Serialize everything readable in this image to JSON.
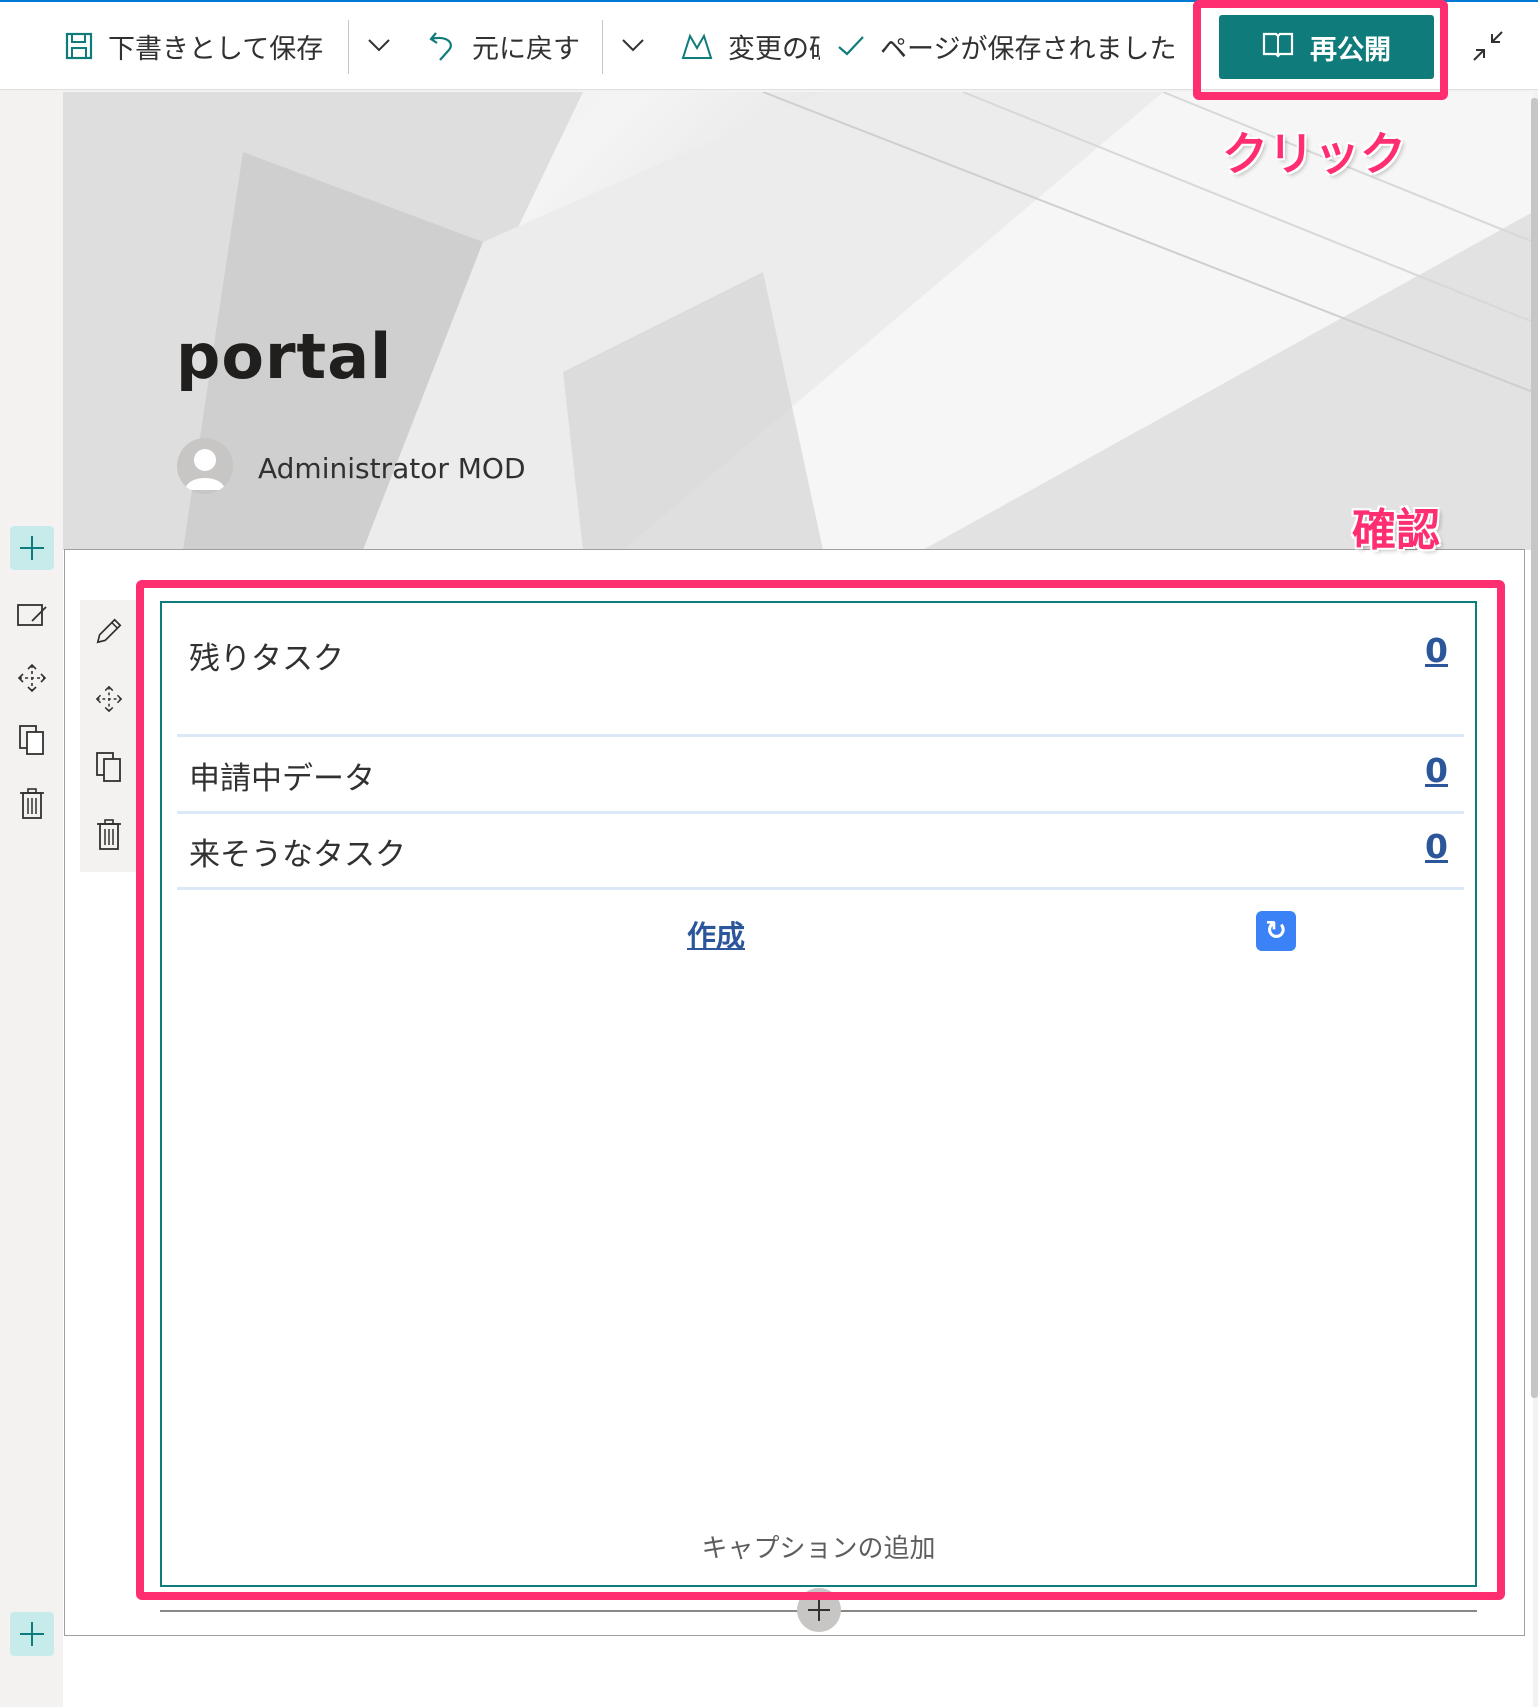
{
  "command_bar": {
    "save_draft_label": "下書きとして保存",
    "undo_label": "元に戻す",
    "discard_label": "変更の破",
    "saved_status": "ページが保存されました",
    "republish_label": "再公開"
  },
  "annotations": {
    "click_label": "クリック",
    "confirm_label": "確認",
    "color": "#ff2e71"
  },
  "page": {
    "title": "portal",
    "author": "Administrator MOD"
  },
  "webpart": {
    "rows": [
      {
        "label": "残りタスク",
        "count": "0"
      },
      {
        "label": "申請中データ",
        "count": "0"
      },
      {
        "label": "来そうなタスク",
        "count": "0"
      }
    ],
    "create_label": "作成",
    "refresh_icon": "↻",
    "caption": "キャプションの追加"
  },
  "colors": {
    "accent": "#0f7b7b",
    "link": "#2b579a",
    "annotation": "#ff2e71"
  }
}
